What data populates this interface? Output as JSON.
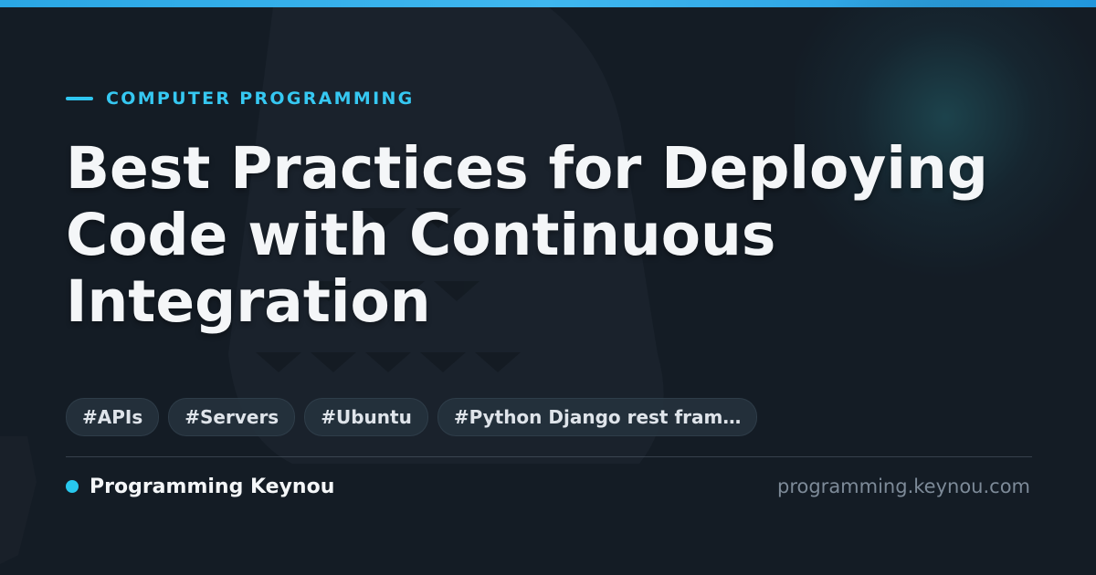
{
  "header": {
    "category": "COMPUTER PROGRAMMING",
    "title": "Best Practices for Deploying Code with Continuous Integration"
  },
  "tags": [
    "#APIs",
    "#Servers",
    "#Ubuntu",
    "#Python Django rest fram…"
  ],
  "footer": {
    "brand": "Programming Keynou",
    "url": "programming.keynou.com"
  },
  "colors": {
    "accent": "#36c8f2",
    "background": "#141c25",
    "title": "#f4f6f8",
    "tag_bg": "#26323e",
    "muted": "#7d8a98"
  }
}
